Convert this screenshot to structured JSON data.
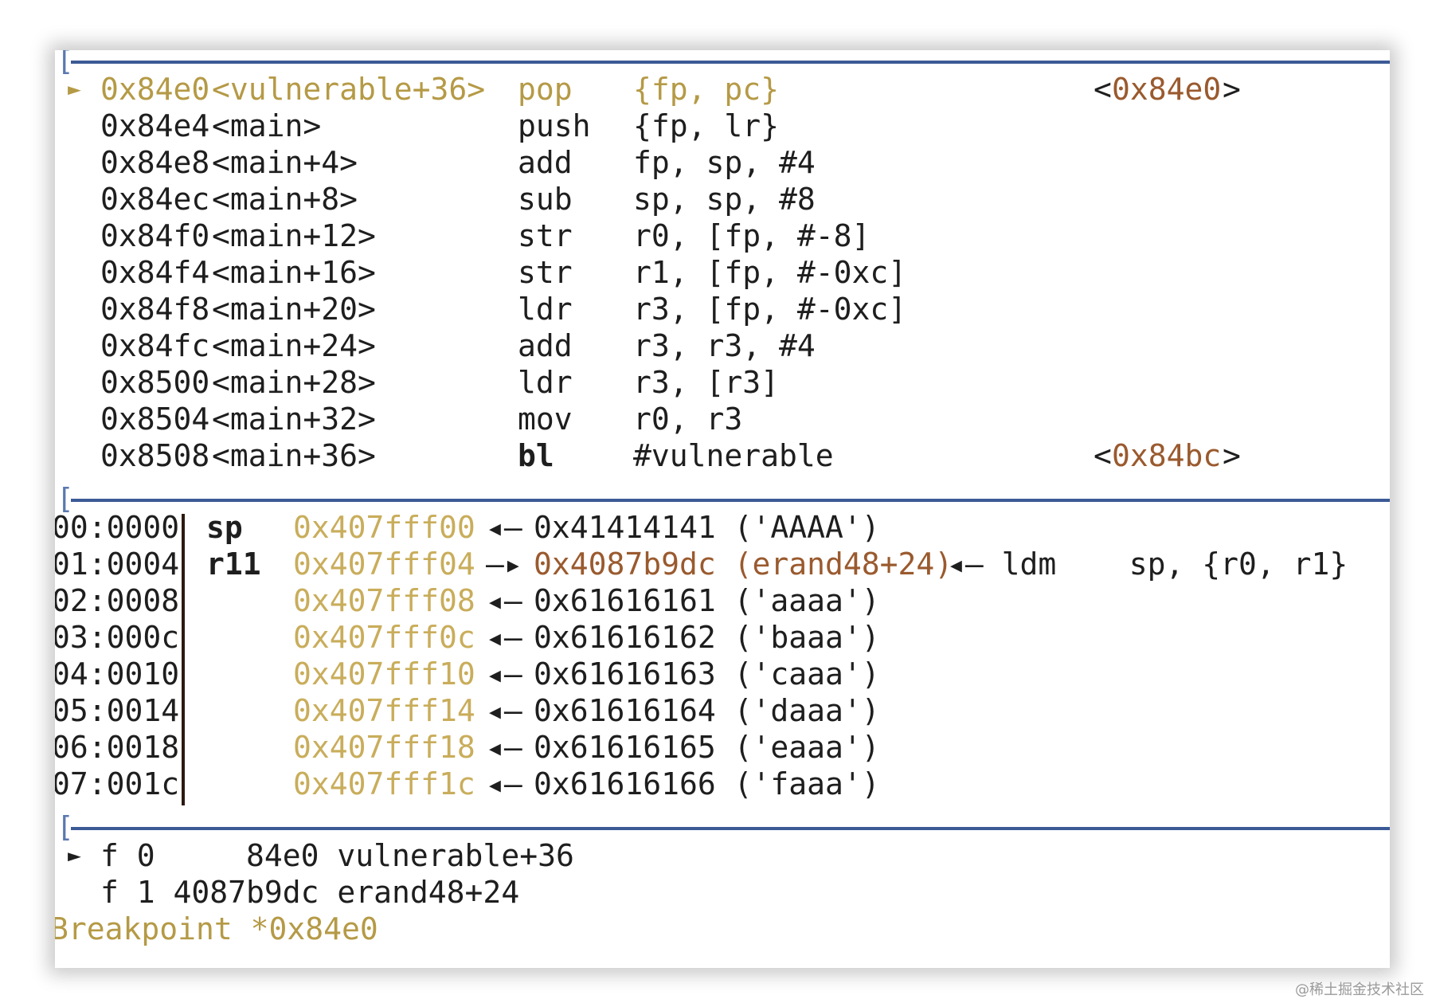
{
  "disasm": {
    "rows": [
      {
        "marker": "►",
        "addr": "0x84e0",
        "sym": "<vulnerable+36>",
        "op": "pop",
        "args": "{fp, pc}",
        "target_open": "<",
        "target": "0x84e0",
        "target_close": ">"
      },
      {
        "marker": "",
        "addr": "0x84e4",
        "sym": "<main>",
        "op": "push",
        "args": "{fp, lr}",
        "target_open": "",
        "target": "",
        "target_close": ""
      },
      {
        "marker": "",
        "addr": "0x84e8",
        "sym": "<main+4>",
        "op": "add",
        "args": "fp, sp, #4",
        "target_open": "",
        "target": "",
        "target_close": ""
      },
      {
        "marker": "",
        "addr": "0x84ec",
        "sym": "<main+8>",
        "op": "sub",
        "args": "sp, sp, #8",
        "target_open": "",
        "target": "",
        "target_close": ""
      },
      {
        "marker": "",
        "addr": "0x84f0",
        "sym": "<main+12>",
        "op": "str",
        "args": "r0, [fp, #-8]",
        "target_open": "",
        "target": "",
        "target_close": ""
      },
      {
        "marker": "",
        "addr": "0x84f4",
        "sym": "<main+16>",
        "op": "str",
        "args": "r1, [fp, #-0xc]",
        "target_open": "",
        "target": "",
        "target_close": ""
      },
      {
        "marker": "",
        "addr": "0x84f8",
        "sym": "<main+20>",
        "op": "ldr",
        "args": "r3, [fp, #-0xc]",
        "target_open": "",
        "target": "",
        "target_close": ""
      },
      {
        "marker": "",
        "addr": "0x84fc",
        "sym": "<main+24>",
        "op": "add",
        "args": "r3, r3, #4",
        "target_open": "",
        "target": "",
        "target_close": ""
      },
      {
        "marker": "",
        "addr": "0x8500",
        "sym": "<main+28>",
        "op": "ldr",
        "args": "r3, [r3]",
        "target_open": "",
        "target": "",
        "target_close": ""
      },
      {
        "marker": "",
        "addr": "0x8504",
        "sym": "<main+32>",
        "op": "mov",
        "args": "r0, r3",
        "target_open": "",
        "target": "",
        "target_close": ""
      },
      {
        "marker": "",
        "addr": "0x8508",
        "sym": "<main+36>",
        "op": "bl",
        "args": "#vulnerable",
        "target_open": "<",
        "target": "0x84bc",
        "target_close": ">"
      }
    ]
  },
  "stack": {
    "rows": [
      {
        "idx": "00:0000",
        "reg": "sp",
        "addr": "0x407fff00",
        "arrow": "◂—",
        "value": "0x41414141 ('AAAA')",
        "extra": ""
      },
      {
        "idx": "01:0004",
        "reg": "r11",
        "addr": "0x407fff04",
        "arrow": "—▸",
        "value": "0x4087b9dc (erand48+24)",
        "extra": "◂— ldm    sp, {r0, r1}"
      },
      {
        "idx": "02:0008",
        "reg": "",
        "addr": "0x407fff08",
        "arrow": "◂—",
        "value": "0x61616161 ('aaaa')",
        "extra": ""
      },
      {
        "idx": "03:000c",
        "reg": "",
        "addr": "0x407fff0c",
        "arrow": "◂—",
        "value": "0x61616162 ('baaa')",
        "extra": ""
      },
      {
        "idx": "04:0010",
        "reg": "",
        "addr": "0x407fff10",
        "arrow": "◂—",
        "value": "0x61616163 ('caaa')",
        "extra": ""
      },
      {
        "idx": "05:0014",
        "reg": "",
        "addr": "0x407fff14",
        "arrow": "◂—",
        "value": "0x61616164 ('daaa')",
        "extra": ""
      },
      {
        "idx": "06:0018",
        "reg": "",
        "addr": "0x407fff18",
        "arrow": "◂—",
        "value": "0x61616165 ('eaaa')",
        "extra": ""
      },
      {
        "idx": "07:001c",
        "reg": "",
        "addr": "0x407fff1c",
        "arrow": "◂—",
        "value": "0x61616166 ('faaa')",
        "extra": ""
      }
    ]
  },
  "backtrace": {
    "rows": [
      {
        "marker": "►",
        "text": "f 0     84e0 vulnerable+36"
      },
      {
        "marker": "",
        "text": "f 1 4087b9dc erand48+24"
      }
    ]
  },
  "status": {
    "breakpoint": "Breakpoint *0x84e0"
  },
  "separators": {
    "bracket": "["
  },
  "watermark": "@稀土掘金技术社区",
  "colors": {
    "current_line": "#b59a46",
    "stack_address": "#c9ad5b",
    "deref_value": "#9a5a2e",
    "separator": "#3c5a96"
  }
}
